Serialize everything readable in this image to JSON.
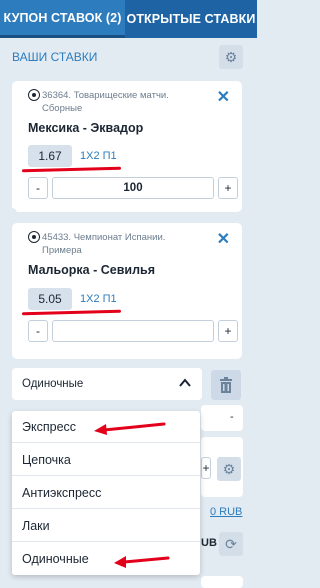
{
  "tabs": [
    {
      "label": "Купон ставок (2)",
      "active": true
    },
    {
      "label": "Открытые ставки",
      "active": false
    }
  ],
  "header": {
    "title": "Ваши ставки",
    "settings_icon": "gear-icon"
  },
  "bets": [
    {
      "meta": "36364. Товарищеские матчи. Сборные",
      "match": "Мексика - Эквадор",
      "coef": "1.67",
      "market": "1X2 П1",
      "minus": "-",
      "plus": "+",
      "stake": "100"
    },
    {
      "meta": "45433. Чемпионат Испании. Примера",
      "match": "Мальорка - Севилья",
      "coef": "5.05",
      "market": "1X2 П1",
      "minus": "-",
      "plus": "+",
      "stake": ""
    }
  ],
  "bet_type": {
    "selected": "Одиночные",
    "options": [
      "Экспресс",
      "Цепочка",
      "Антиэкспресс",
      "Лаки",
      "Одиночные"
    ]
  },
  "background": {
    "dash": "-",
    "plus": "+",
    "amount": "0 RUB",
    "currency": "UB"
  },
  "colors": {
    "accent": "#2d7cbd",
    "tab_bar": "#1f6fb0",
    "highlight_red": "#e3001b",
    "background": "#e3ebf2"
  }
}
